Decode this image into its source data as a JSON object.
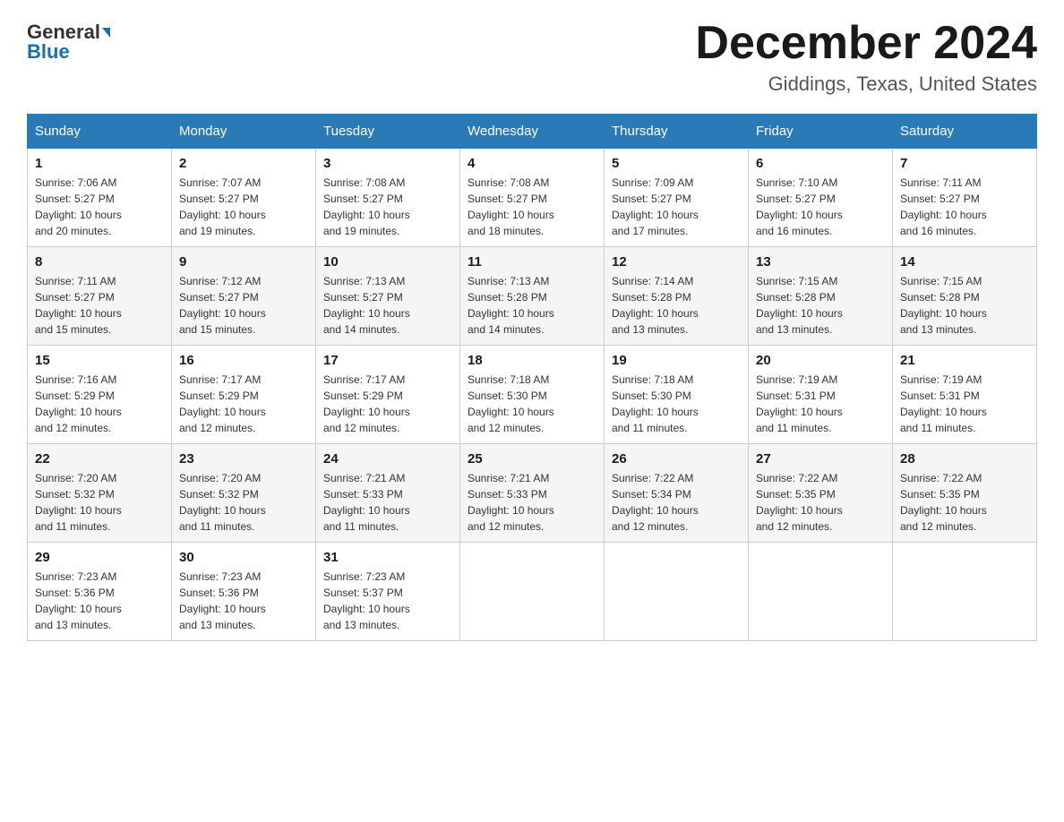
{
  "header": {
    "logo_general": "General",
    "logo_blue": "Blue",
    "month_title": "December 2024",
    "location": "Giddings, Texas, United States"
  },
  "days_of_week": [
    "Sunday",
    "Monday",
    "Tuesday",
    "Wednesday",
    "Thursday",
    "Friday",
    "Saturday"
  ],
  "weeks": [
    [
      {
        "day": "1",
        "sunrise": "7:06 AM",
        "sunset": "5:27 PM",
        "daylight": "10 hours and 20 minutes."
      },
      {
        "day": "2",
        "sunrise": "7:07 AM",
        "sunset": "5:27 PM",
        "daylight": "10 hours and 19 minutes."
      },
      {
        "day": "3",
        "sunrise": "7:08 AM",
        "sunset": "5:27 PM",
        "daylight": "10 hours and 19 minutes."
      },
      {
        "day": "4",
        "sunrise": "7:08 AM",
        "sunset": "5:27 PM",
        "daylight": "10 hours and 18 minutes."
      },
      {
        "day": "5",
        "sunrise": "7:09 AM",
        "sunset": "5:27 PM",
        "daylight": "10 hours and 17 minutes."
      },
      {
        "day": "6",
        "sunrise": "7:10 AM",
        "sunset": "5:27 PM",
        "daylight": "10 hours and 16 minutes."
      },
      {
        "day": "7",
        "sunrise": "7:11 AM",
        "sunset": "5:27 PM",
        "daylight": "10 hours and 16 minutes."
      }
    ],
    [
      {
        "day": "8",
        "sunrise": "7:11 AM",
        "sunset": "5:27 PM",
        "daylight": "10 hours and 15 minutes."
      },
      {
        "day": "9",
        "sunrise": "7:12 AM",
        "sunset": "5:27 PM",
        "daylight": "10 hours and 15 minutes."
      },
      {
        "day": "10",
        "sunrise": "7:13 AM",
        "sunset": "5:27 PM",
        "daylight": "10 hours and 14 minutes."
      },
      {
        "day": "11",
        "sunrise": "7:13 AM",
        "sunset": "5:28 PM",
        "daylight": "10 hours and 14 minutes."
      },
      {
        "day": "12",
        "sunrise": "7:14 AM",
        "sunset": "5:28 PM",
        "daylight": "10 hours and 13 minutes."
      },
      {
        "day": "13",
        "sunrise": "7:15 AM",
        "sunset": "5:28 PM",
        "daylight": "10 hours and 13 minutes."
      },
      {
        "day": "14",
        "sunrise": "7:15 AM",
        "sunset": "5:28 PM",
        "daylight": "10 hours and 13 minutes."
      }
    ],
    [
      {
        "day": "15",
        "sunrise": "7:16 AM",
        "sunset": "5:29 PM",
        "daylight": "10 hours and 12 minutes."
      },
      {
        "day": "16",
        "sunrise": "7:17 AM",
        "sunset": "5:29 PM",
        "daylight": "10 hours and 12 minutes."
      },
      {
        "day": "17",
        "sunrise": "7:17 AM",
        "sunset": "5:29 PM",
        "daylight": "10 hours and 12 minutes."
      },
      {
        "day": "18",
        "sunrise": "7:18 AM",
        "sunset": "5:30 PM",
        "daylight": "10 hours and 12 minutes."
      },
      {
        "day": "19",
        "sunrise": "7:18 AM",
        "sunset": "5:30 PM",
        "daylight": "10 hours and 11 minutes."
      },
      {
        "day": "20",
        "sunrise": "7:19 AM",
        "sunset": "5:31 PM",
        "daylight": "10 hours and 11 minutes."
      },
      {
        "day": "21",
        "sunrise": "7:19 AM",
        "sunset": "5:31 PM",
        "daylight": "10 hours and 11 minutes."
      }
    ],
    [
      {
        "day": "22",
        "sunrise": "7:20 AM",
        "sunset": "5:32 PM",
        "daylight": "10 hours and 11 minutes."
      },
      {
        "day": "23",
        "sunrise": "7:20 AM",
        "sunset": "5:32 PM",
        "daylight": "10 hours and 11 minutes."
      },
      {
        "day": "24",
        "sunrise": "7:21 AM",
        "sunset": "5:33 PM",
        "daylight": "10 hours and 11 minutes."
      },
      {
        "day": "25",
        "sunrise": "7:21 AM",
        "sunset": "5:33 PM",
        "daylight": "10 hours and 12 minutes."
      },
      {
        "day": "26",
        "sunrise": "7:22 AM",
        "sunset": "5:34 PM",
        "daylight": "10 hours and 12 minutes."
      },
      {
        "day": "27",
        "sunrise": "7:22 AM",
        "sunset": "5:35 PM",
        "daylight": "10 hours and 12 minutes."
      },
      {
        "day": "28",
        "sunrise": "7:22 AM",
        "sunset": "5:35 PM",
        "daylight": "10 hours and 12 minutes."
      }
    ],
    [
      {
        "day": "29",
        "sunrise": "7:23 AM",
        "sunset": "5:36 PM",
        "daylight": "10 hours and 13 minutes."
      },
      {
        "day": "30",
        "sunrise": "7:23 AM",
        "sunset": "5:36 PM",
        "daylight": "10 hours and 13 minutes."
      },
      {
        "day": "31",
        "sunrise": "7:23 AM",
        "sunset": "5:37 PM",
        "daylight": "10 hours and 13 minutes."
      },
      null,
      null,
      null,
      null
    ]
  ],
  "labels": {
    "sunrise_prefix": "Sunrise: ",
    "sunset_prefix": "Sunset: ",
    "daylight_prefix": "Daylight: "
  }
}
